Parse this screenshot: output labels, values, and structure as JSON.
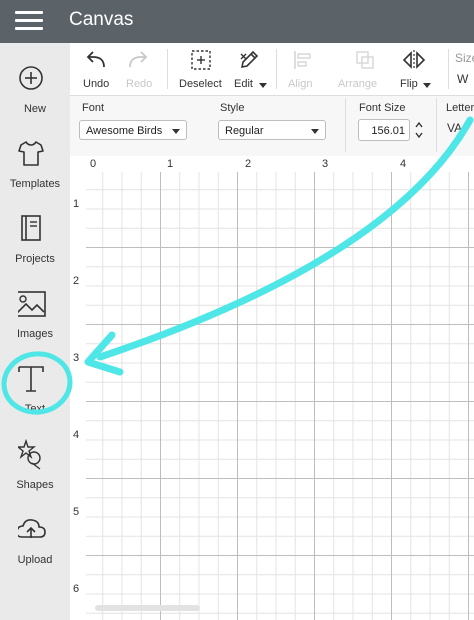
{
  "app": {
    "title": "Canvas"
  },
  "sidebar": {
    "items": [
      {
        "label": "New",
        "icon": "plus-circle-icon"
      },
      {
        "label": "Templates",
        "icon": "tshirt-icon"
      },
      {
        "label": "Projects",
        "icon": "book-icon"
      },
      {
        "label": "Images",
        "icon": "image-icon"
      },
      {
        "label": "Text",
        "icon": "text-t-icon"
      },
      {
        "label": "Shapes",
        "icon": "shapes-icon"
      },
      {
        "label": "Upload",
        "icon": "cloud-upload-icon"
      }
    ]
  },
  "toolbar": {
    "undo": "Undo",
    "redo": "Redo",
    "deselect": "Deselect",
    "edit": "Edit",
    "align": "Align",
    "arrange": "Arrange",
    "flip": "Flip",
    "size_label": "Size",
    "size_w": "W"
  },
  "props": {
    "font_label": "Font",
    "font_value": "Awesome Birds",
    "style_label": "Style",
    "style_value": "Regular",
    "font_size_label": "Font Size",
    "font_size_value": "156.01",
    "letter_label": "Letter",
    "letter_glyph": "VA"
  },
  "ruler": {
    "top": [
      "0",
      "1",
      "2",
      "3",
      "4"
    ],
    "left": [
      "1",
      "2",
      "3",
      "4",
      "5",
      "6"
    ]
  },
  "colors": {
    "topbar": "#5b6369",
    "sidebar": "#eaeaea",
    "annotation": "#4ee6e6"
  }
}
